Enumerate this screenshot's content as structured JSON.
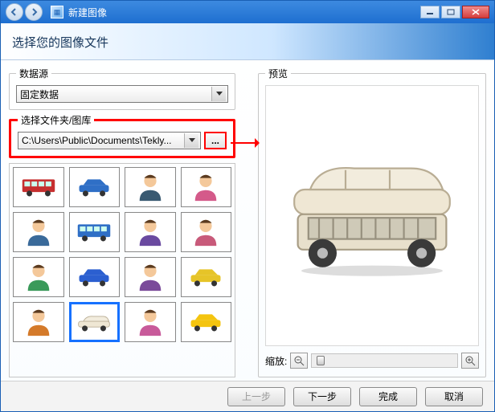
{
  "title": "新建图像",
  "banner": "选择您的图像文件",
  "datasource": {
    "legend": "数据源",
    "value": "固定数据"
  },
  "folder": {
    "legend": "选择文件夹/图库",
    "path": "C:\\Users\\Public\\Documents\\Tekly...",
    "browse": "..."
  },
  "preview": {
    "legend": "预览",
    "zoom_label": "缩放:"
  },
  "thumbs": [
    {
      "name": "bus-red"
    },
    {
      "name": "car-blue"
    },
    {
      "name": "man-suit"
    },
    {
      "name": "woman"
    },
    {
      "name": "man2"
    },
    {
      "name": "bus-blue"
    },
    {
      "name": "man-glasses"
    },
    {
      "name": "woman2"
    },
    {
      "name": "man-green"
    },
    {
      "name": "car-small-blue"
    },
    {
      "name": "man-purple"
    },
    {
      "name": "jeep-yellow"
    },
    {
      "name": "man-orange"
    },
    {
      "name": "car-convertible",
      "selected": true
    },
    {
      "name": "woman3"
    },
    {
      "name": "car-sport-yellow"
    }
  ],
  "footer": {
    "prev": "上一步",
    "next": "下一步",
    "finish": "完成",
    "cancel": "取消"
  }
}
